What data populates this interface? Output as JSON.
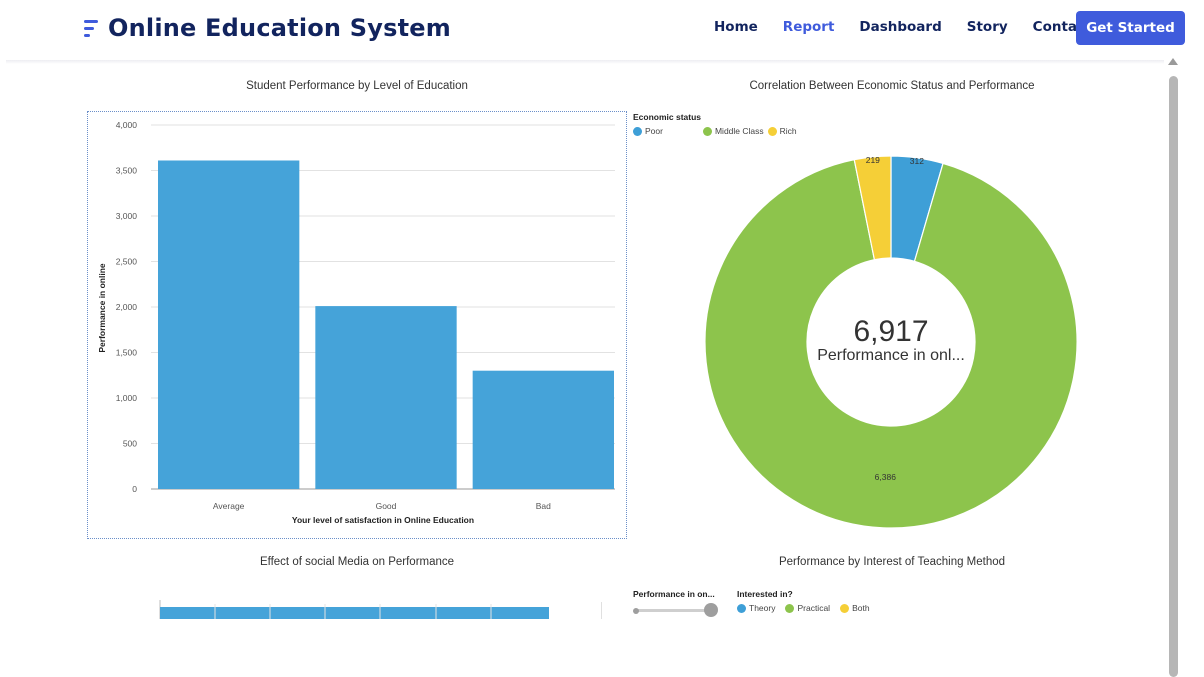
{
  "app": {
    "title": "Online Education System",
    "nav": [
      "Home",
      "Report",
      "Dashboard",
      "Story",
      "Contact"
    ],
    "active_nav": "Report",
    "cta_label": "Get Started",
    "brand_color": "#3f5bdc",
    "text_color": "#12245e"
  },
  "charts": {
    "bar": {
      "title": "Student Performance by Level of Education",
      "xlabel": "Your level of satisfaction in Online Education",
      "ylabel": "Performance in online"
    },
    "donut": {
      "title": "Correlation Between Economic Status and Performance",
      "legend_title": "Economic status",
      "center_value": "6,917",
      "center_label": "Performance in onl..."
    },
    "social": {
      "title": "Effect of social Media on Performance"
    },
    "teaching": {
      "title": "Performance by Interest of Teaching Method",
      "slider_label": "Performance in on...",
      "legend_title": "Interested in?",
      "legend": [
        {
          "label": "Theory",
          "color": "#3e9fd7"
        },
        {
          "label": "Practical",
          "color": "#8dc44c"
        },
        {
          "label": "Both",
          "color": "#f5cf37"
        }
      ]
    }
  },
  "chart_data": [
    {
      "type": "bar",
      "title": "Student Performance by Level of Education",
      "categories": [
        "Average",
        "Good",
        "Bad"
      ],
      "values": [
        3610,
        2010,
        1300
      ],
      "xlabel": "Your level of satisfaction in Online Education",
      "ylabel": "Performance in online",
      "ylim": [
        0,
        4000
      ],
      "yticks": [
        "0",
        "500",
        "1,000",
        "1,500",
        "2,000",
        "2,500",
        "3,000",
        "3,500",
        "4,000"
      ],
      "color": "#45a3d9",
      "grid": true
    },
    {
      "type": "pie",
      "title": "Correlation Between Economic Status and Performance",
      "donut": true,
      "legend_title": "Economic status",
      "legend_position": "top-left",
      "labels": [
        "Poor",
        "Middle Class",
        "Rich"
      ],
      "values": [
        312,
        6386,
        219
      ],
      "value_labels": [
        "312",
        "6,386",
        "219"
      ],
      "colors": [
        "#3e9fd7",
        "#8dc44c",
        "#f5cf37"
      ],
      "total": "6,917"
    }
  ]
}
